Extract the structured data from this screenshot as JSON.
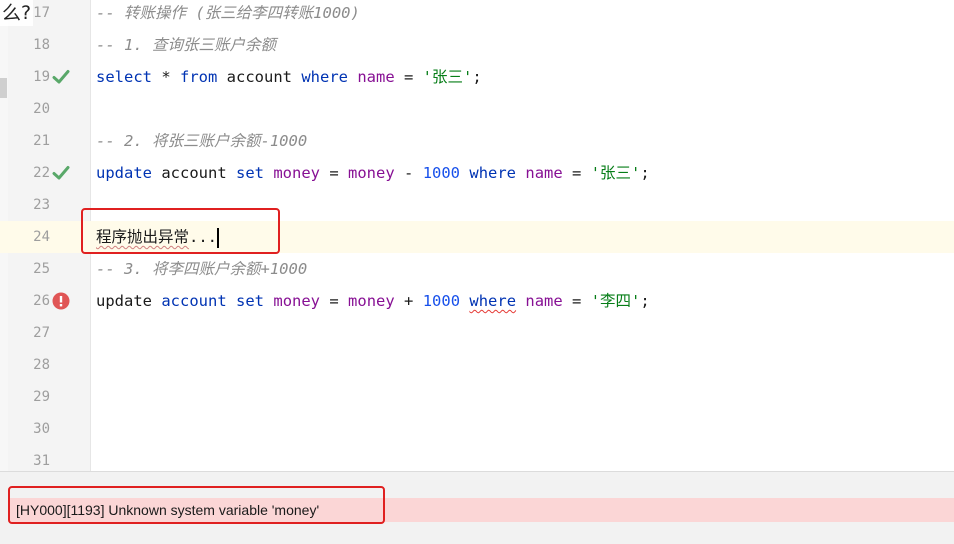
{
  "editor": {
    "lines": [
      {
        "num": "17",
        "icon": "none",
        "tokens": [
          {
            "t": "-- 转账操作 (张三给李四转账1000)",
            "c": "comment"
          }
        ]
      },
      {
        "num": "18",
        "icon": "none",
        "tokens": [
          {
            "t": "-- 1. 查询张三账户余额",
            "c": "comment"
          }
        ]
      },
      {
        "num": "19",
        "icon": "check",
        "tokens": [
          {
            "t": "select",
            "c": "kw"
          },
          {
            "t": " * ",
            "c": "plain"
          },
          {
            "t": "from",
            "c": "kw"
          },
          {
            "t": " account ",
            "c": "plain"
          },
          {
            "t": "where",
            "c": "kw"
          },
          {
            "t": " ",
            "c": "plain"
          },
          {
            "t": "name",
            "c": "col"
          },
          {
            "t": " = ",
            "c": "plain"
          },
          {
            "t": "'张三'",
            "c": "str"
          },
          {
            "t": ";",
            "c": "plain"
          }
        ]
      },
      {
        "num": "20",
        "icon": "none",
        "tokens": []
      },
      {
        "num": "21",
        "icon": "none",
        "tokens": [
          {
            "t": "-- 2. 将张三账户余额-1000",
            "c": "comment"
          }
        ]
      },
      {
        "num": "22",
        "icon": "check",
        "tokens": [
          {
            "t": "update",
            "c": "kw"
          },
          {
            "t": " account ",
            "c": "plain"
          },
          {
            "t": "set",
            "c": "kw"
          },
          {
            "t": " ",
            "c": "plain"
          },
          {
            "t": "money",
            "c": "col"
          },
          {
            "t": " = ",
            "c": "plain"
          },
          {
            "t": "money",
            "c": "col"
          },
          {
            "t": " - ",
            "c": "plain"
          },
          {
            "t": "1000",
            "c": "num"
          },
          {
            "t": " ",
            "c": "plain"
          },
          {
            "t": "where",
            "c": "kw"
          },
          {
            "t": " ",
            "c": "plain"
          },
          {
            "t": "name",
            "c": "col"
          },
          {
            "t": " = ",
            "c": "plain"
          },
          {
            "t": "'张三'",
            "c": "str"
          },
          {
            "t": ";",
            "c": "plain"
          }
        ]
      },
      {
        "num": "23",
        "icon": "none",
        "tokens": []
      },
      {
        "num": "24",
        "icon": "none",
        "current": true,
        "tokens": [
          {
            "t": "程序抛出异常",
            "c": "plain squiggle-soft"
          },
          {
            "t": "...",
            "c": "plain"
          },
          {
            "caret": true
          }
        ]
      },
      {
        "num": "25",
        "icon": "none",
        "tokens": [
          {
            "t": "-- 3. 将李四账户余额+1000",
            "c": "comment"
          }
        ]
      },
      {
        "num": "26",
        "icon": "error",
        "tokens": [
          {
            "t": "update",
            "c": "plain"
          },
          {
            "t": " ",
            "c": "plain"
          },
          {
            "t": "account",
            "c": "kw"
          },
          {
            "t": " ",
            "c": "plain"
          },
          {
            "t": "set",
            "c": "kw"
          },
          {
            "t": " ",
            "c": "plain"
          },
          {
            "t": "money",
            "c": "col"
          },
          {
            "t": " = ",
            "c": "plain"
          },
          {
            "t": "money",
            "c": "col"
          },
          {
            "t": " + ",
            "c": "plain"
          },
          {
            "t": "1000",
            "c": "num"
          },
          {
            "t": " ",
            "c": "plain"
          },
          {
            "t": "where",
            "c": "kw squiggle"
          },
          {
            "t": " ",
            "c": "plain"
          },
          {
            "t": "name",
            "c": "col"
          },
          {
            "t": " = ",
            "c": "plain"
          },
          {
            "t": "'李四'",
            "c": "str"
          },
          {
            "t": ";",
            "c": "plain"
          }
        ]
      },
      {
        "num": "27",
        "icon": "none",
        "tokens": []
      },
      {
        "num": "28",
        "icon": "none",
        "tokens": []
      },
      {
        "num": "29",
        "icon": "none",
        "tokens": []
      },
      {
        "num": "30",
        "icon": "none",
        "tokens": []
      },
      {
        "num": "31",
        "icon": "none",
        "tokens": []
      }
    ]
  },
  "overlay_text": "么?",
  "status": {
    "error_message": "[HY000][1193] Unknown system variable 'money'"
  },
  "colors": {
    "check": "#59a869",
    "error": "#e05555",
    "annotation_box": "#e02020",
    "error_background": "#fbd6d6"
  }
}
